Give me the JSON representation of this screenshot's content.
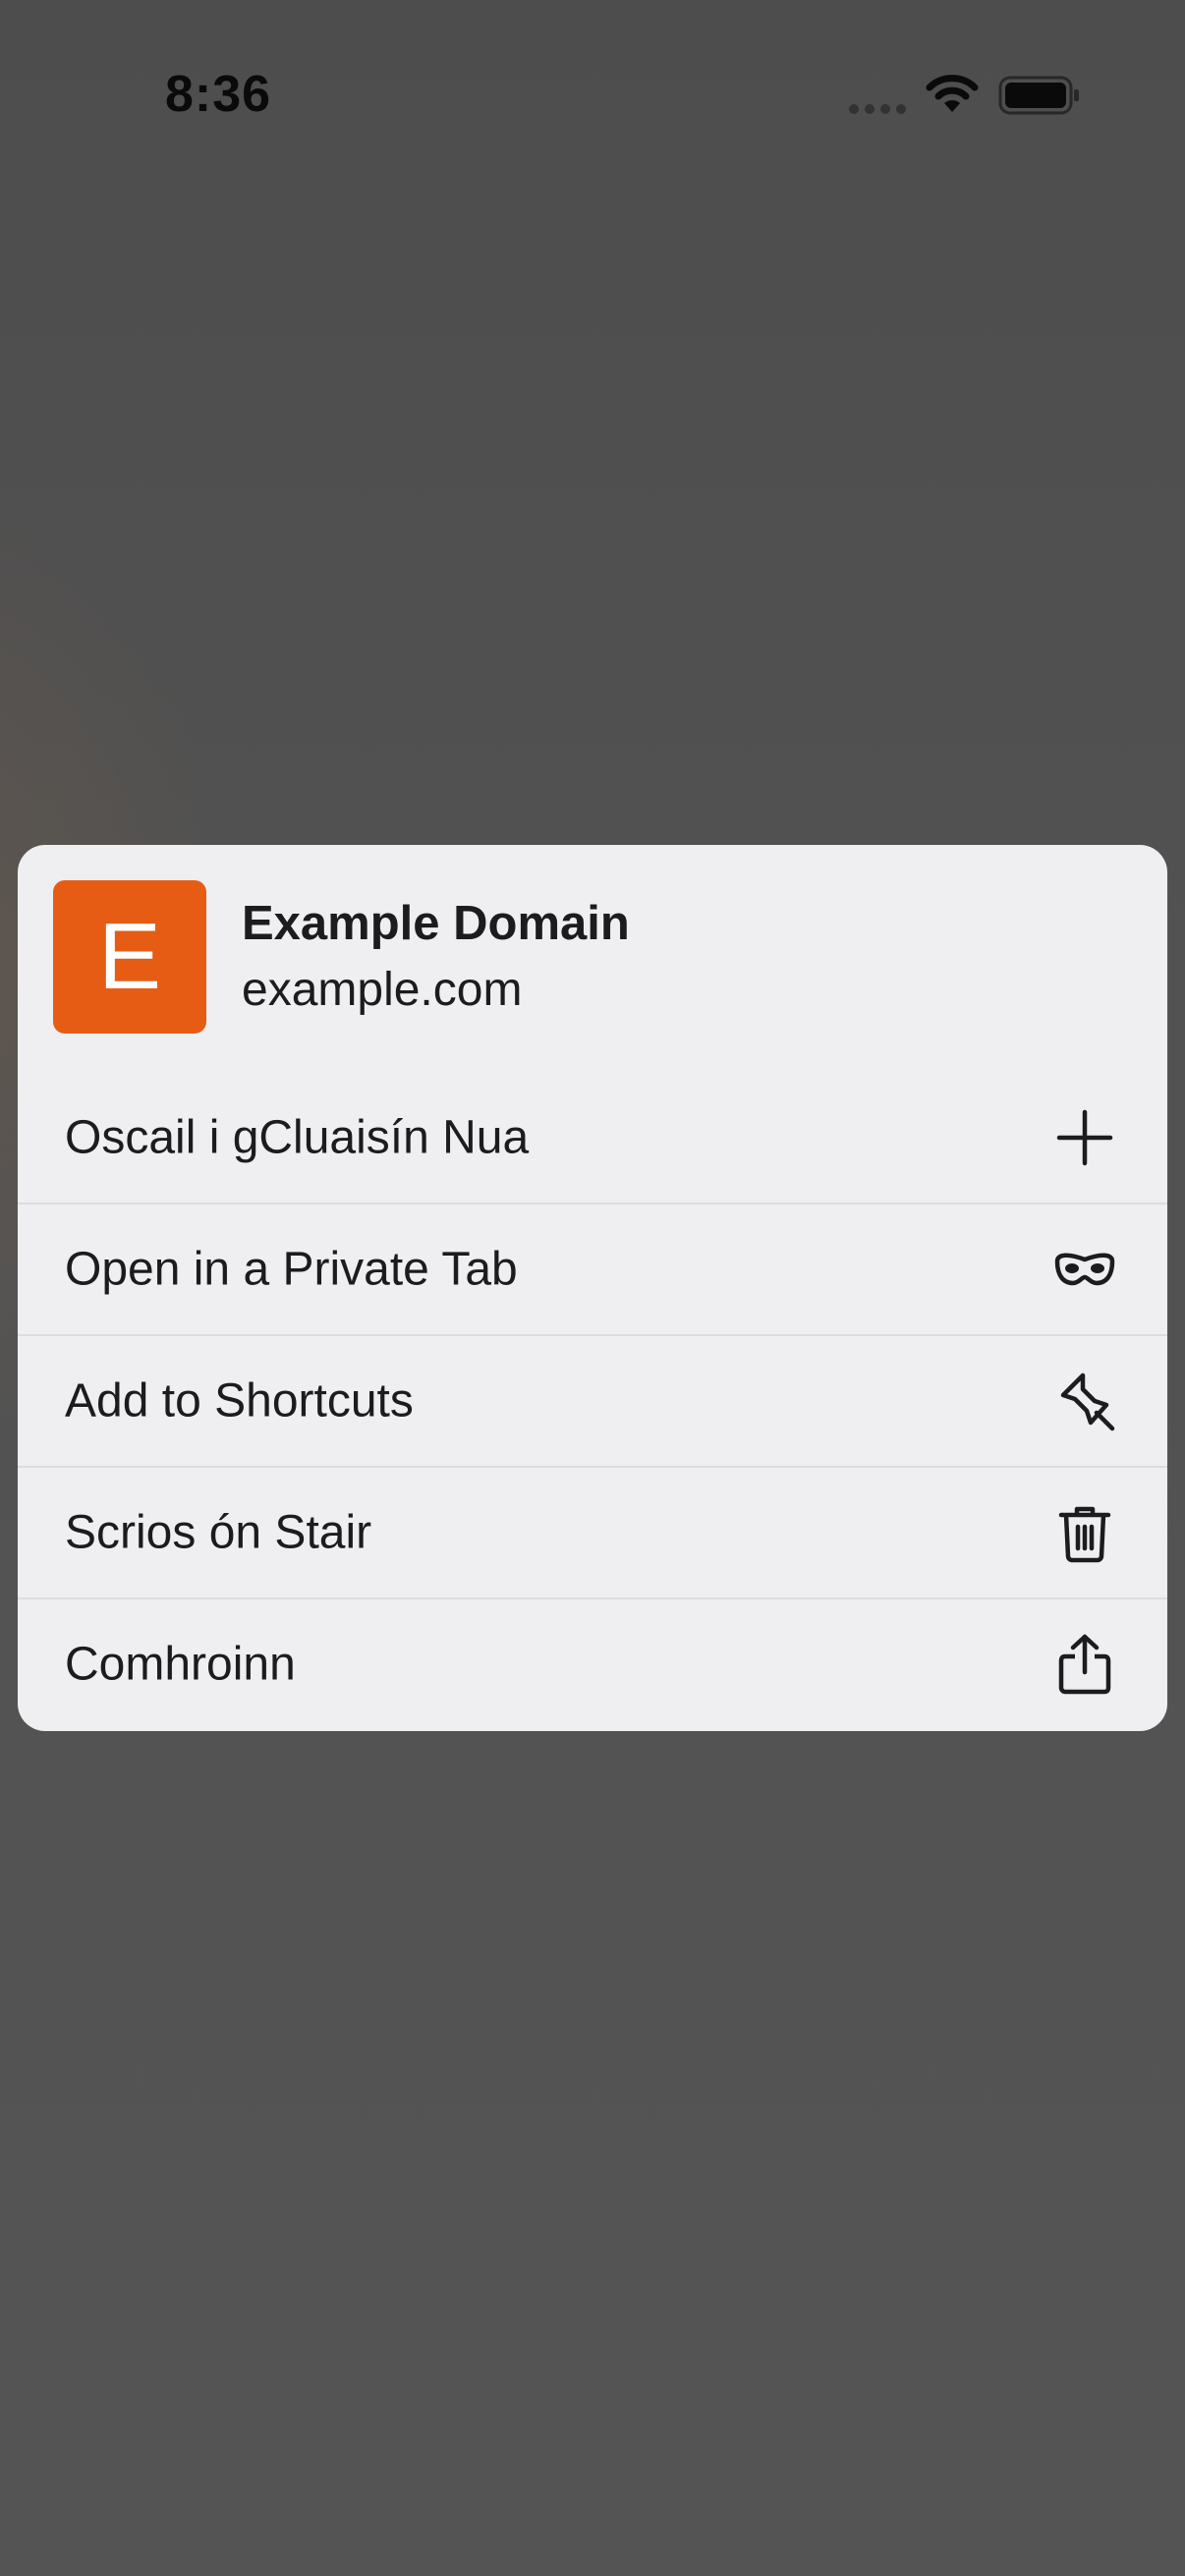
{
  "status_bar": {
    "time": "8:36"
  },
  "preview": {
    "favicon_letter": "E",
    "favicon_color": "#e65c14",
    "title": "Example Domain",
    "url": "example.com"
  },
  "menu": {
    "items": [
      {
        "label": "Oscail i gCluaisín Nua",
        "icon": "plus-icon"
      },
      {
        "label": "Open in a Private Tab",
        "icon": "private-mask-icon"
      },
      {
        "label": "Add to Shortcuts",
        "icon": "pin-icon"
      },
      {
        "label": "Scrios ón Stair",
        "icon": "trash-icon"
      },
      {
        "label": "Comhroinn",
        "icon": "share-icon"
      }
    ]
  }
}
